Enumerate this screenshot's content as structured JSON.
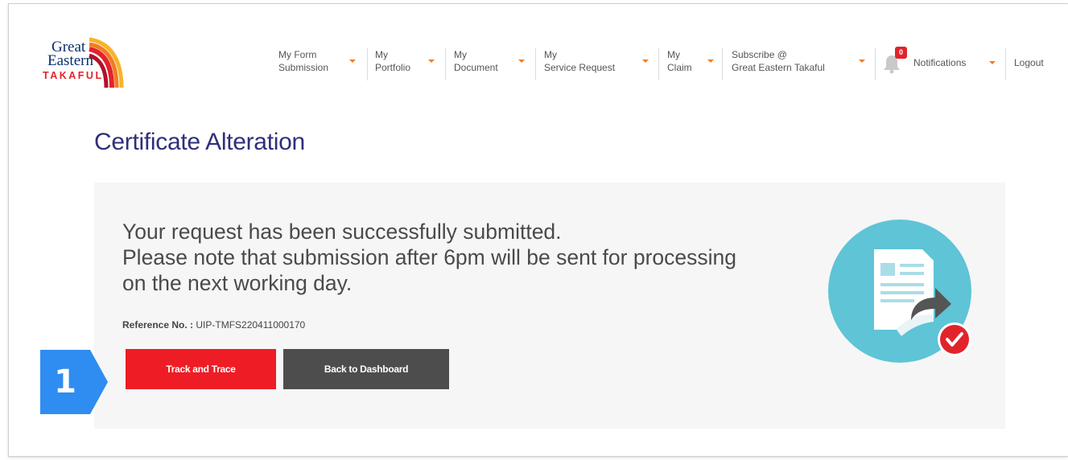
{
  "brand": {
    "logo_line1": "Great",
    "logo_line2": "Eastern",
    "logo_line3": "TAKAFUL",
    "primary_color": "#0b2e6f",
    "accent_color": "#e2232b"
  },
  "nav": {
    "items": [
      {
        "line1": "My Form",
        "line2": "Submission"
      },
      {
        "line1": "My",
        "line2": "Portfolio"
      },
      {
        "line1": "My",
        "line2": "Document"
      },
      {
        "line1": "My",
        "line2": "Service Request"
      },
      {
        "line1": "My",
        "line2": "Claim"
      },
      {
        "line1": "Subscribe @",
        "line2": "Great Eastern Takaful"
      }
    ],
    "notifications_label": "Notifications",
    "notifications_count": "0",
    "logout_label": "Logout",
    "caret_color": "#f47b20"
  },
  "page": {
    "title": "Certificate Alteration"
  },
  "confirmation": {
    "line1": "Your request has been successfully submitted.",
    "line2": "Please note that submission after 6pm will be sent for processing",
    "line3": "on the next working day.",
    "reference_label": "Reference No. :",
    "reference_value": "UIP-TMFS220411000170"
  },
  "actions": {
    "track_label": "Track and Trace",
    "dashboard_label": "Back to Dashboard"
  },
  "callout": {
    "number": "1",
    "color": "#2f8cf0"
  },
  "illustration": {
    "icon": "document-forward-check-icon",
    "circle_color": "#5ec4d6"
  }
}
